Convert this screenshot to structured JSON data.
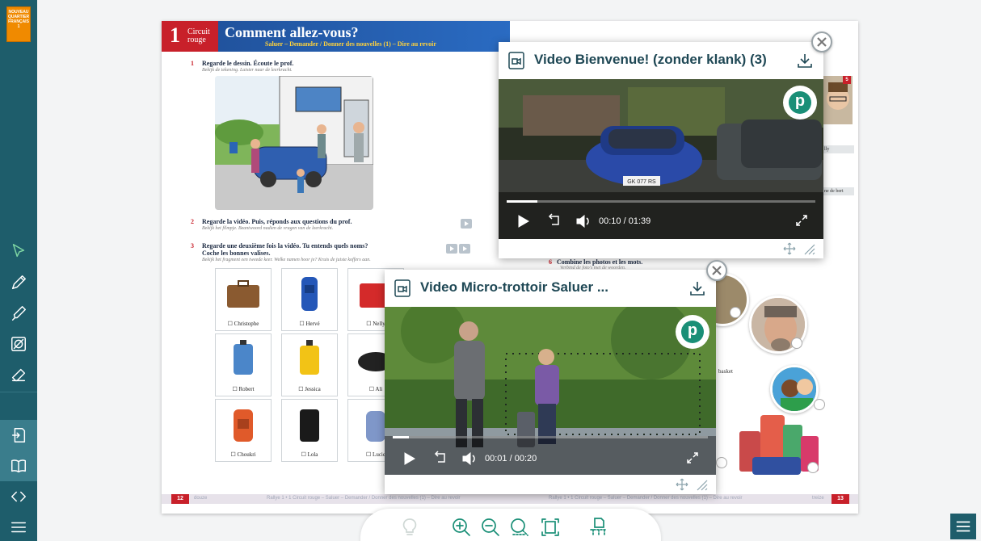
{
  "brand": {
    "logo_lines": [
      "NOUVEAU",
      "QUARTIER",
      "FRANÇAIS",
      "1"
    ]
  },
  "toolbar": {
    "tools": [
      {
        "name": "pointer-icon",
        "active": true
      },
      {
        "name": "pencil-icon"
      },
      {
        "name": "highlighter-icon"
      },
      {
        "name": "hide-icon"
      },
      {
        "name": "eraser-icon"
      },
      {
        "name": "export-icon"
      },
      {
        "name": "book-icon"
      },
      {
        "name": "code-nav-icon"
      },
      {
        "name": "menu-icon"
      }
    ]
  },
  "book": {
    "left": {
      "lesson_number": "1",
      "circuit_label_1": "Circuit",
      "circuit_label_2": "rouge",
      "title": "Comment allez-vous?",
      "subtitle": "Saluer – Demander / Donner des nouvelles (1) – Dire au revoir",
      "exercises": [
        {
          "num": "1",
          "text": "Regarde le dessin. Écoute le prof.",
          "nl": "Bekijk de tekening. Luister naar de leerkracht."
        },
        {
          "num": "2",
          "text": "Regarde la vidéo. Puis, réponds aux questions du prof.",
          "nl": "Bekijk het filmpje. Beantwoord nadien de vragen van de leerkracht."
        },
        {
          "num": "3",
          "text": "Regarde une deuxième fois la vidéo. Tu entends quels noms?",
          "text2": "Coche les bonnes valises.",
          "nl": "Bekijk het fragment een tweede keer. Welke namen hoor je? Kruis de juiste koffers aan."
        }
      ],
      "cards": [
        {
          "label": "☐ Christophe"
        },
        {
          "label": "☐ Hervé"
        },
        {
          "label": "☐ Nelly"
        },
        {
          "label": "☐ Robert"
        },
        {
          "label": "☐ Jessica"
        },
        {
          "label": "☐ Ali"
        },
        {
          "label": "☐ Choukri"
        },
        {
          "label": "☐ Lola"
        },
        {
          "label": "☐ Lucie"
        }
      ],
      "page_number": "12",
      "page_word": "douze",
      "footer_text": "Rallye 1 • 1 Circuit rouge – Saluer – Demander / Donner des nouvelles (1) – Dire au revoir"
    },
    "right": {
      "exercise6": {
        "num": "6",
        "text": "Combine les photos et les mots.",
        "nl": "Verbind de foto's met de woorden."
      },
      "side_labels": [
        "lly",
        "ne de bert",
        "basket"
      ],
      "corner_badge": "5",
      "page_number": "13",
      "page_word": "treize",
      "footer_text": "Rallye 1 • 1 Circuit rouge – Saluer – Demander / Donner des nouvelles (1) – Dire au revoir"
    }
  },
  "video1": {
    "title": "Video Bienvenue! (zonder klank) (3)",
    "current": "00:10",
    "sep": "/",
    "duration": "01:39",
    "progress": 0.1,
    "plate": "GK 077 RS",
    "logo_letter": "p"
  },
  "video2": {
    "title": "Video Micro-trottoir Saluer ...",
    "current": "00:01",
    "sep": "/",
    "duration": "00:20",
    "progress": 0.05,
    "logo_letter": "p"
  },
  "zoombar": {
    "buttons": [
      "lightbulb-icon",
      "zoom-in-icon",
      "zoom-out-icon",
      "zoom-select-icon",
      "fit-page-icon",
      "single-page-icon"
    ]
  },
  "colors": {
    "sidebar": "#1e5d6b",
    "accent": "#1a8f77",
    "lesson_red": "#c8202a",
    "lesson_blue": "#1f4e96",
    "video_title": "#1f4855"
  }
}
